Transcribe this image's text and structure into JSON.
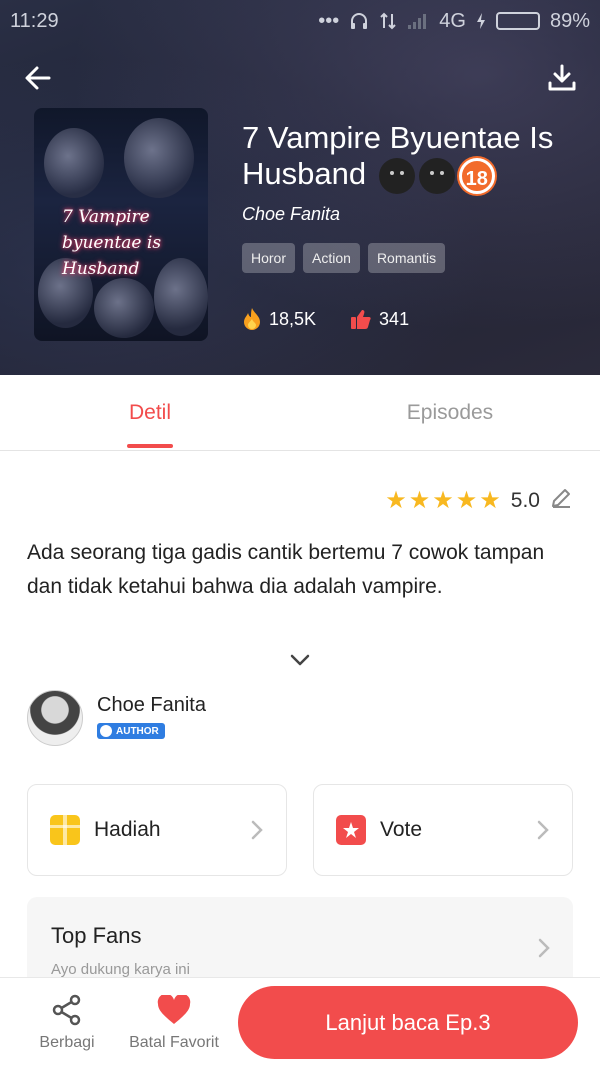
{
  "status_bar": {
    "time": "11:29",
    "network": "4G",
    "battery": "89%",
    "battery_level": 0.89
  },
  "header": {
    "back_icon": "arrow-left-icon",
    "download_icon": "download-icon"
  },
  "book": {
    "cover_text_line1": "7 Vampire",
    "cover_text_line2": "byuentae is",
    "cover_text_line3": "Husband",
    "title": "7 Vampire Byuentae Is Husband",
    "title_badge": "18",
    "author": "Choe Fanita",
    "tags": [
      "Horor",
      "Action",
      "Romantis"
    ],
    "views": "18,5K",
    "likes": "341"
  },
  "tabs": [
    {
      "label": "Detil",
      "active": true
    },
    {
      "label": "Episodes",
      "active": false
    }
  ],
  "rating": {
    "stars": 5,
    "value": "5.0"
  },
  "description": "Ada seorang tiga gadis cantik bertemu 7 cowok tampan dan tidak ketahui bahwa dia adalah vampire.",
  "author_section": {
    "name": "Choe Fanita",
    "badge": "AUTHOR"
  },
  "cards": {
    "gift_label": "Hadiah",
    "vote_label": "Vote"
  },
  "fans": {
    "title": "Top Fans",
    "subtitle": "Ayo dukung karya ini"
  },
  "bottom_bar": {
    "share_label": "Berbagi",
    "favorite_label": "Batal Favorit",
    "read_label": "Lanjut baca Ep.3"
  },
  "colors": {
    "accent": "#f24c4c",
    "star": "#f8b820",
    "author_badge": "#2f7de1"
  }
}
